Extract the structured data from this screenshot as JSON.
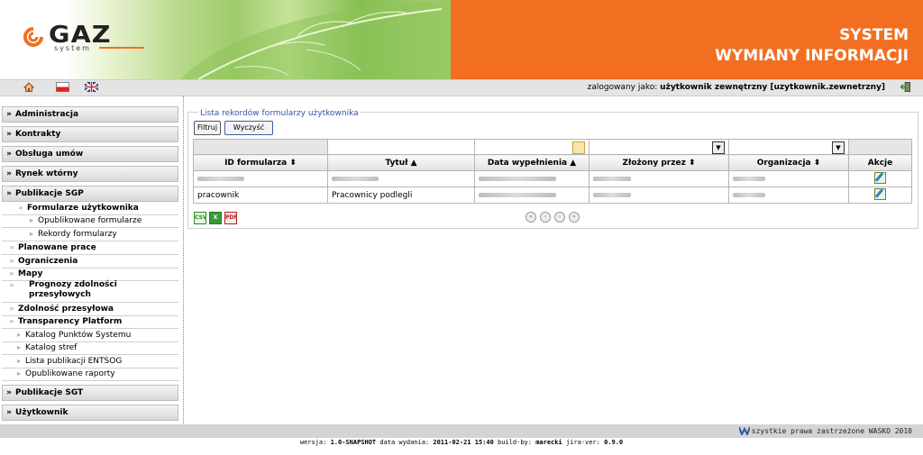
{
  "header": {
    "logo_text": "GAZ",
    "logo_sub": "system",
    "title_line1": "SYSTEM",
    "title_line2": "WYMIANY INFORMACJI",
    "accent_color": "#f26f22"
  },
  "topbar": {
    "icons": [
      "home-icon",
      "polish-flag-icon",
      "uk-flag-icon"
    ],
    "logged_label": "zalogowany jako:",
    "logged_user": "użytkownik zewnętrzny [uzytkownik.zewnetrzny]",
    "logout_icon": "logout-icon"
  },
  "sidebar": {
    "sections": [
      {
        "label": "Administracja",
        "icon": "chevron-down-icon"
      },
      {
        "label": "Kontrakty",
        "icon": "chevron-down-icon"
      },
      {
        "label": "Obsługa umów",
        "icon": "chevron-down-icon"
      },
      {
        "label": "Rynek wtórny",
        "icon": "chevron-down-icon"
      },
      {
        "label": "Publikacje SGP",
        "icon": "chevron-right-icon"
      },
      {
        "label": "Publikacje SGT",
        "icon": "chevron-down-icon"
      },
      {
        "label": "Użytkownik",
        "icon": "chevron-down-icon"
      }
    ],
    "sgp_items": {
      "formularze": "Formularze użytkownika",
      "opublikowane_formularze": "Opublikowane formularze",
      "rekordy": "Rekordy formularzy",
      "planowane": "Planowane prace",
      "ograniczenia": "Ograniczenia",
      "mapy": "Mapy",
      "prognozy": "Prognozy zdolności przesyłowych",
      "zdolnosc": "Zdolność przesyłowa",
      "transparency": "Transparency Platform",
      "katalog_punktow": "Katalog Punktów Systemu",
      "katalog_stref": "Katalog stref",
      "lista_entsog": "Lista publikacji ENTSOG",
      "raporty": "Opublikowane raporty"
    }
  },
  "main": {
    "panel_title": "Lista rekordów formularzy użytkownika",
    "filter_button": "Filtruj",
    "clear_button": "Wyczyść",
    "columns": [
      "ID formularza ⬍",
      "Tytuł ▲",
      "Data wypełnienia ▲",
      "Złożony przez ⬍",
      "Organizacja ⬍",
      "Akcje"
    ],
    "rows": [
      {
        "id": "",
        "title": "",
        "date": "",
        "by": "",
        "org": "",
        "action_icon": "edit-icon"
      },
      {
        "id": "pracownik",
        "title": "Pracownicy podlegli",
        "date": "",
        "by": "",
        "org": "",
        "action_icon": "edit-icon"
      }
    ],
    "export_icons": [
      "csv-export-icon",
      "excel-export-icon",
      "pdf-export-icon"
    ],
    "pager_icons": [
      "first-page-icon",
      "prev-page-icon",
      "next-page-icon",
      "last-page-icon"
    ]
  },
  "footer": {
    "rights": "szystkie prawa zastrzeżone WASKO 2010",
    "version_prefix": "wersja:",
    "version": "1.0-SNAPSHOT",
    "date_prefix": "data wydania:",
    "date": "2011-02-21 15:40",
    "build_prefix": "build-by:",
    "build_by": "marecki",
    "jira_prefix": "jira-ver:",
    "jira": "0.9.0"
  }
}
